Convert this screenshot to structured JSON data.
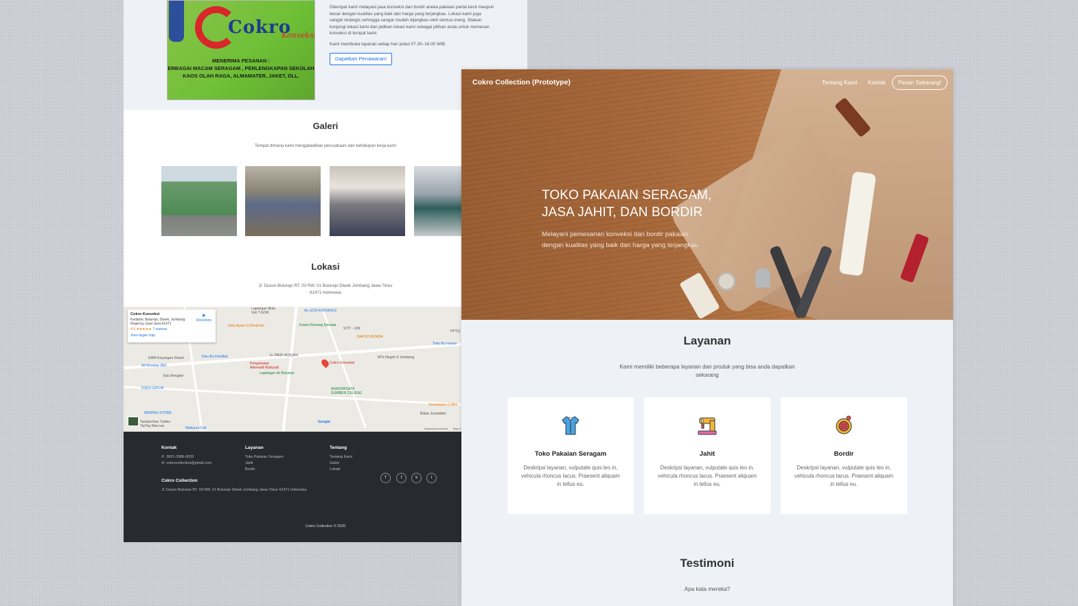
{
  "left": {
    "about": {
      "banner_brand": "Cokro",
      "banner_brand2": "Konveksi",
      "banner_line1": "MENERIMA PESANAN :",
      "banner_line2": "ERBAGAI MACAM SERAGAM , PERLENGKAPAN SEKOLAH",
      "banner_line3": "KAOS OLAH RAGA, ALMAMATER, JAKET, DLL.",
      "para1": "Ditempat kami melayani jasa konveksi dan bordir aneka pakaian partai kecil maupun besar dengan kualitas yang baik dan harga yang terjangkau. Lokasi kami juga sangat strategis sehingga sangat mudah dijangkau oleh semua orang. Silakan kunjungi lokasi kami dan jadikan lokasi kami sebagai pilihan anda untuk memesan konveksi di tempat kami.",
      "para2": "Kami membuka layanan setiap hari pukul 07.30–16.00 WIB.",
      "cta": "Dapatkan Penawaran!"
    },
    "gallery": {
      "title": "Galeri",
      "subtitle": "Tempat dimana kami mengabadikan perusahaan dan kehidupan kerja kami"
    },
    "location": {
      "title": "Lokasi",
      "address": "Jl. Dusun Bulurejo RT. 03 RW. 01 Bulurejo Diwek Jombang Jawa Timur 61471 Indonesia"
    },
    "map": {
      "place_name": "Cokro Konveksi",
      "place_address": "Kedaton, Bulurejo, Diwek, Jombang Regency, East Java 61471",
      "rating": "4.9 ★★★★★",
      "reviews": "7 reviews",
      "directions": "Directions",
      "larger_map": "View larger map",
      "labels": [
        "AL-IZZA KONVEKSI",
        "Kolam Renang Dewata",
        "Soto Ayam H.Sholichin",
        "STIT - UW",
        "BAKSO BUNDA",
        "DAM Kayangan Diwek",
        "Toko Bu Kholifah",
        "H. PAIDI AQIQAH",
        "Cokro Konveksi",
        "MTs Negeri 9 Jombang",
        "Art Arwana JBG",
        "Pengobatan Alternatif Wahyudi",
        "Lapangan ds Bulurejo",
        "Eko Bengkel",
        "TOKO CATUR",
        "AGROWISATA SUMBER CELENG",
        "REWISH STORE",
        "Semanjana Coffee",
        "Bidan Jumaidah",
        "Tambal Ban Tubles TipTop Mas Ian",
        "Wahyuni Cell",
        "Lapangan Bola Voli T.GOR",
        "Toko Bu marlan",
        "PPTQ"
      ],
      "footer_keys": "Keyboard shortcuts",
      "footer_data": "Map d",
      "google": "Google"
    },
    "footer": {
      "kontak_title": "Kontak",
      "phone": "0821-3986-0033",
      "email": "cokrocollection@gmail.com",
      "company_title": "Cokro Collection",
      "company_address": "Jl. Dusun Bulurejo RT. 03 RW. 01 Bulurejo Diwek Jombang Jawa Timur 61471 Indonesia",
      "layanan_title": "Layanan",
      "layanan_items": [
        "Toko Pakaian Seragam",
        "Jahit",
        "Bordir"
      ],
      "tentang_title": "Tentang",
      "tentang_items": [
        "Tentang Kami",
        "Galeri",
        "Lokasi"
      ],
      "social": [
        "f",
        "t",
        "s",
        "i"
      ],
      "copyright": "Cokro Collection © 2020"
    }
  },
  "right": {
    "nav": {
      "brand": "Cokro Collection (Prototype)",
      "link_about": "Tentang Kami",
      "link_contact": "Kontak",
      "cta": "Pesan Sekarang!"
    },
    "hero": {
      "title": "TOKO PAKAIAN SERAGAM, JASA JAHIT, DAN BORDIR",
      "subtitle": "Melayani pemesanan konveksi dan bordir pakaian dengan kualitas yang baik dan harga yang terjangkau"
    },
    "services": {
      "title": "Layanan",
      "subtitle": "Kami memiliki beberapa layanan dan produk yang bisa anda dapatkan sekarang",
      "cards": [
        {
          "icon": "shirt-icon",
          "title": "Toko Pakaian Seragam",
          "desc": "Deskripsi layanan, vulputate quis leo in, vehicula rhoncus lacus. Praesent aliquam in tellus eu."
        },
        {
          "icon": "sewing-machine-icon",
          "title": "Jahit",
          "desc": "Deskripsi layanan, vulputate quis leo in, vehicula rhoncus lacus. Praesent aliquam in tellus eu."
        },
        {
          "icon": "thread-spool-icon",
          "title": "Bordir",
          "desc": "Deskripsi layanan, vulputate quis leo in, vehicula rhoncus lacus. Praesent aliquam in tellus eu."
        }
      ]
    },
    "testimonials": {
      "title": "Testimoni",
      "subtitle": "Apa kata mereka?"
    }
  },
  "colors": {
    "accent_blue": "#1a73e8",
    "footer_bg": "#272b30",
    "page_bg": "#eef1f5",
    "icon_orange": "#f7b731",
    "icon_red": "#e54b4b",
    "icon_blue": "#4aa3df"
  }
}
